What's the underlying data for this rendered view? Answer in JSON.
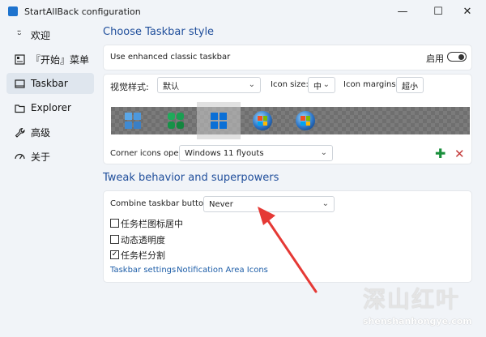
{
  "titlebar": {
    "title": "StartAllBack configuration",
    "min": "—",
    "max": "☐",
    "close": "✕"
  },
  "sidebar": {
    "items": [
      {
        "icon": "smile-icon",
        "label": "欢迎"
      },
      {
        "icon": "start-menu-icon",
        "label": "『开始』菜单"
      },
      {
        "icon": "taskbar-icon",
        "label": "Taskbar"
      },
      {
        "icon": "explorer-icon",
        "label": "Explorer"
      },
      {
        "icon": "wrench-icon",
        "label": "高级"
      },
      {
        "icon": "about-icon",
        "label": "关于"
      }
    ]
  },
  "main": {
    "heading_style": "Choose Taskbar style",
    "enhanced_label": "Use enhanced classic taskbar",
    "enable_label": "启用",
    "visual_style_label": "视觉样式:",
    "visual_style_value": "默认",
    "icon_size_label": "Icon size:",
    "icon_size_value": "中",
    "icon_margins_label": "Icon margins:",
    "icon_margins_value": "超小",
    "corner_icons_label": "Corner icons open:",
    "corner_icons_value": "Windows 11 flyouts",
    "heading_tweak": "Tweak behavior and superpowers",
    "combine_label": "Combine taskbar buttons:",
    "combine_value": "Never",
    "check_center": "任务栏图标居中",
    "check_dynamic": "动态透明度",
    "check_split": "任务栏分割",
    "link_taskbar_settings": "Taskbar settings",
    "link_notification_icons": "Notification Area Icons"
  },
  "watermark": {
    "logo": "深山红叶",
    "url": "shenshanhongye.com"
  },
  "colors": {
    "accent_heading": "#1f4e9b",
    "plus": "#1a8f3c",
    "remove": "#c43b3b",
    "annotation": "#e53935"
  }
}
